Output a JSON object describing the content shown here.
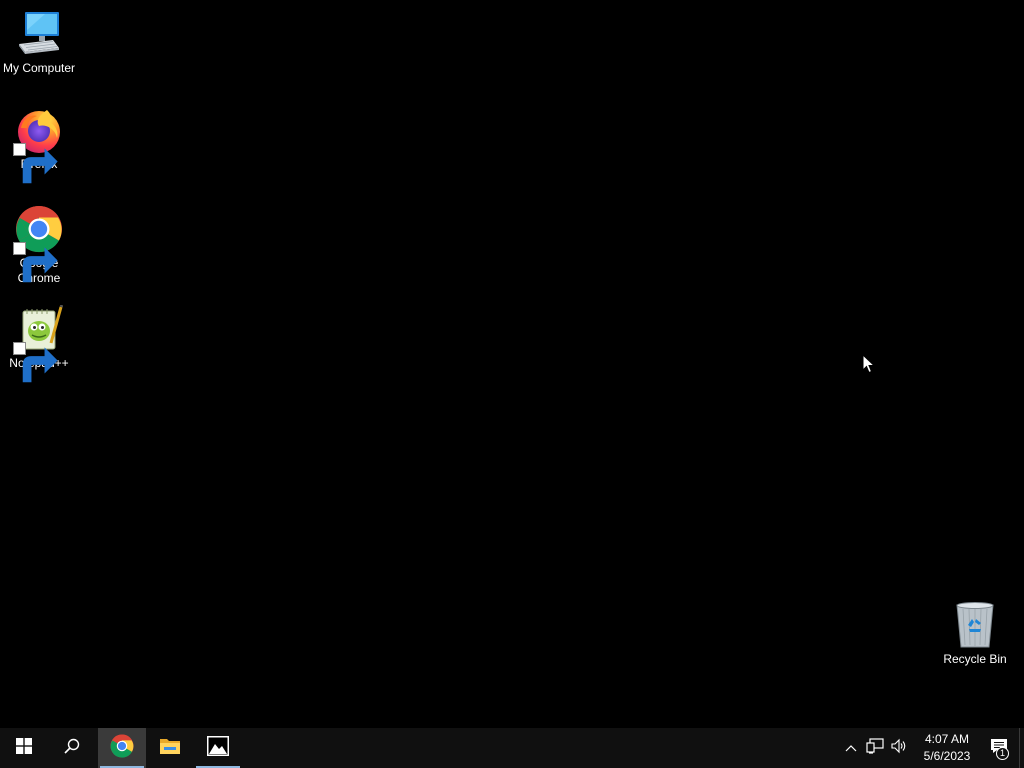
{
  "desktop": {
    "icons": [
      {
        "label": "My Computer",
        "icon": "computer-icon",
        "shortcut": false
      },
      {
        "label": "Firefox",
        "icon": "firefox-icon",
        "shortcut": true
      },
      {
        "label": "Google Chrome",
        "icon": "chrome-icon",
        "shortcut": true
      },
      {
        "label": "Notepad++",
        "icon": "notepadpp-icon",
        "shortcut": true
      },
      {
        "label": "Recycle Bin",
        "icon": "recycle-bin-icon",
        "shortcut": false
      }
    ]
  },
  "taskbar": {
    "buttons": [
      {
        "name": "start",
        "icon": "windows-start-icon",
        "active": false
      },
      {
        "name": "search",
        "icon": "search-icon",
        "active": false
      },
      {
        "name": "chrome",
        "icon": "chrome-icon",
        "active": true,
        "running": true
      },
      {
        "name": "file-explorer",
        "icon": "folder-icon",
        "active": false
      },
      {
        "name": "photos",
        "icon": "photos-icon",
        "active": false,
        "running": true
      }
    ],
    "tray": {
      "icons": [
        "chevron-up-icon",
        "network-icon",
        "volume-icon"
      ],
      "time": "4:07 AM",
      "date": "5/6/2023",
      "notification_count": "1"
    }
  },
  "colors": {
    "desktop_bg": "#000000",
    "taskbar_bg": "#101010",
    "taskbar_active": "#3a3a3a",
    "running_indicator": "#8fb8e0"
  }
}
